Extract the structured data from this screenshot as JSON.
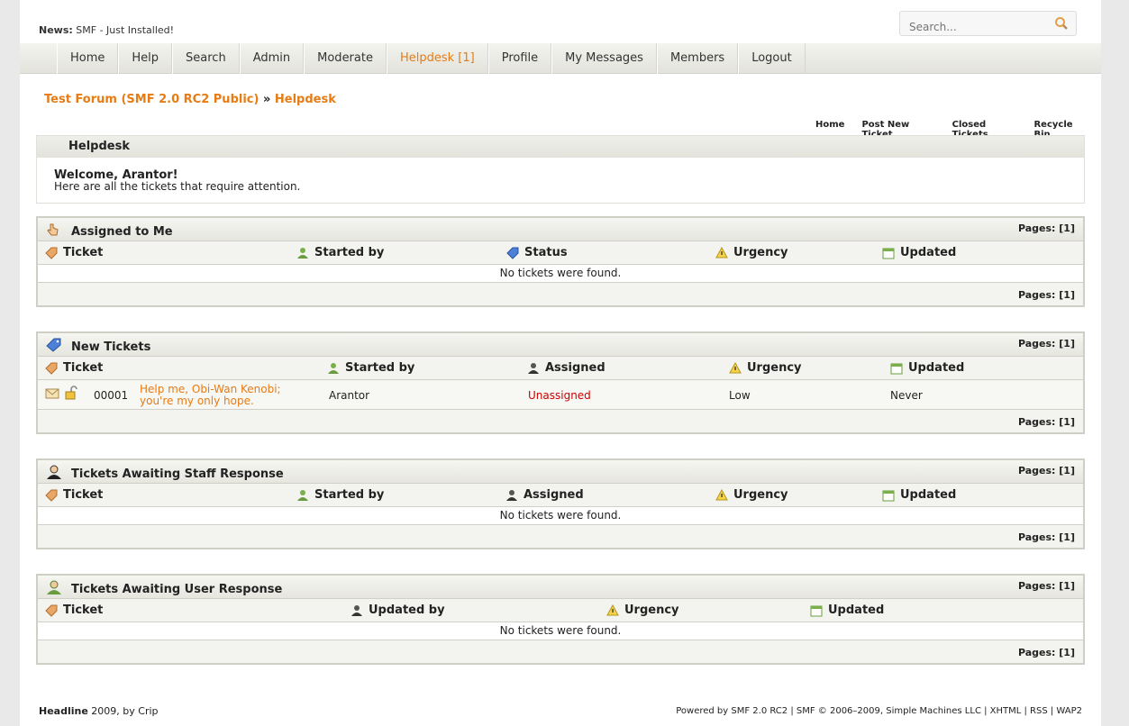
{
  "news": {
    "label": "News:",
    "text": "SMF - Just Installed!"
  },
  "search": {
    "placeholder": "Search..."
  },
  "nav": {
    "items": [
      "Home",
      "Help",
      "Search",
      "Admin",
      "Moderate",
      "Helpdesk [1]",
      "Profile",
      "My Messages",
      "Members",
      "Logout"
    ],
    "active_index": 5
  },
  "breadcrumb": {
    "forum": "Test Forum (SMF 2.0 RC2 Public)",
    "separator": "»",
    "current": "Helpdesk"
  },
  "subnav": [
    "Home",
    "Post New Ticket",
    "Closed Tickets",
    "Recycle Bin"
  ],
  "helpdesk": {
    "title": "Helpdesk",
    "welcome": "Welcome, Arantor!",
    "message": "Here are all the tickets that require attention."
  },
  "pages_label": "Pages: [1]",
  "empty_text": "No tickets were found.",
  "assigned": {
    "title": "Assigned to Me",
    "columns": [
      "Ticket",
      "Started by",
      "Status",
      "Urgency",
      "Updated"
    ]
  },
  "new_tickets": {
    "title": "New Tickets",
    "columns": [
      "Ticket",
      "Started by",
      "Assigned",
      "Urgency",
      "Updated"
    ],
    "row": {
      "id": "00001",
      "subject_1": "Help me, Obi-Wan Kenobi;",
      "subject_2": "you're my only hope.",
      "started_by": "Arantor",
      "assigned": "Unassigned",
      "urgency": "Low",
      "updated": "Never"
    }
  },
  "staff": {
    "title": "Tickets Awaiting Staff Response",
    "columns": [
      "Ticket",
      "Started by",
      "Assigned",
      "Urgency",
      "Updated"
    ]
  },
  "user": {
    "title": "Tickets Awaiting User Response",
    "columns": [
      "Ticket",
      "Updated by",
      "Urgency",
      "Updated"
    ]
  },
  "footer": {
    "left_bold": "Headline",
    "left_rest": "2009, by Crip",
    "right": "Powered by SMF 2.0 RC2 | SMF © 2006–2009, Simple Machines LLC | XHTML | RSS | WAP2"
  },
  "colors": {
    "accent": "#e77b14",
    "unassigned": "#cc0000"
  }
}
